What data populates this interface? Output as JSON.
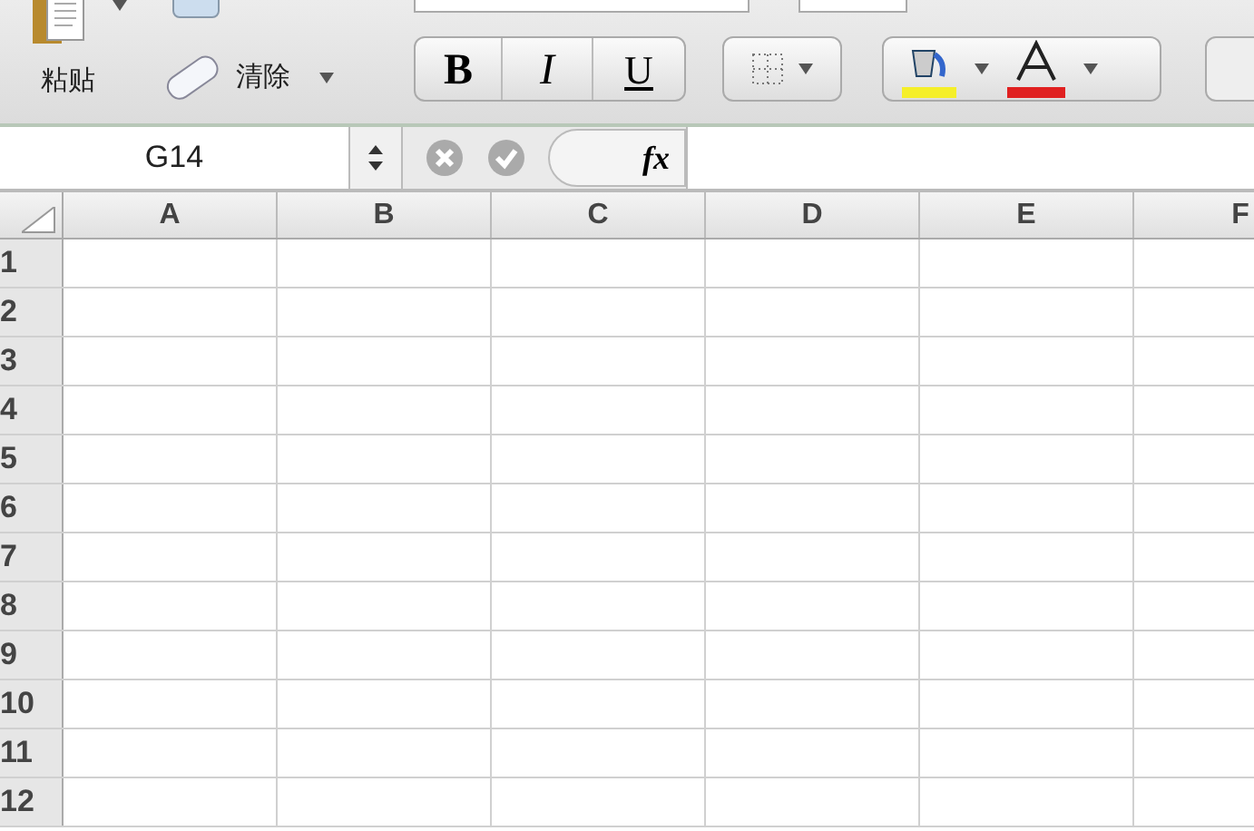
{
  "toolbar": {
    "paste_label": "粘贴",
    "clear_label": "清除",
    "bold": "B",
    "italic": "I",
    "underline": "U"
  },
  "formula_bar": {
    "name_box": "G14",
    "fx": "fx"
  },
  "columns": [
    "A",
    "B",
    "C",
    "D",
    "E",
    "F"
  ],
  "rows": [
    "1",
    "2",
    "3",
    "4",
    "5",
    "6",
    "7",
    "8",
    "9",
    "10",
    "11",
    "12"
  ]
}
